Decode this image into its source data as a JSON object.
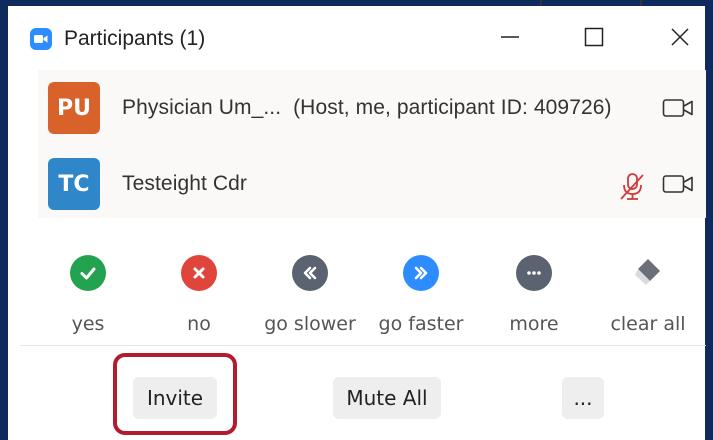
{
  "window": {
    "title": "Participants (1)",
    "minimize_icon": "minimize-icon",
    "maximize_icon": "maximize-icon",
    "close_icon": "close-icon"
  },
  "participants": [
    {
      "initials": "PU",
      "avatar_color": "#d9622b",
      "name": "Physician Um_...",
      "role": "(Host, me, participant ID: 409726)",
      "icons": [
        "video-icon"
      ]
    },
    {
      "initials": "TC",
      "avatar_color": "#2f86c8",
      "name": "Testeight Cdr",
      "role": "",
      "icons": [
        "mic-muted-icon",
        "video-icon"
      ]
    }
  ],
  "reactions": [
    {
      "label": "yes",
      "color": "#23a350",
      "icon": "check-icon"
    },
    {
      "label": "no",
      "color": "#e0453b",
      "icon": "x-icon"
    },
    {
      "label": "go slower",
      "color": "#5b6270",
      "icon": "rewind-icon"
    },
    {
      "label": "go faster",
      "color": "#2d8cff",
      "icon": "fast-forward-icon"
    },
    {
      "label": "more",
      "color": "#5b6270",
      "icon": "more-icon"
    },
    {
      "label": "clear all",
      "color": "#6a6f78",
      "icon": "eraser-icon"
    }
  ],
  "footer": {
    "invite_label": "Invite",
    "mute_all_label": "Mute All",
    "more_label": "..."
  },
  "colors": {
    "highlight": "#b31b2e",
    "frame": "#0f2a5c",
    "muted_mic": "#d23a3a"
  }
}
